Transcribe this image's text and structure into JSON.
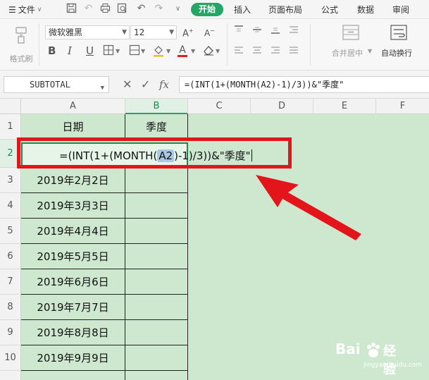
{
  "menubar": {
    "file": "文件",
    "tabs": [
      "开始",
      "插入",
      "页面布局",
      "公式",
      "数据",
      "审阅"
    ]
  },
  "ribbon": {
    "format_painter": "格式刷",
    "font_name": "微软雅黑",
    "font_size": "12",
    "merge_center": "合并居中",
    "wrap_text": "自动换行"
  },
  "formula_bar": {
    "name_box": "SUBTOTAL",
    "formula": "=(INT(1+(MONTH(A2)-1)/3))&\"季度\""
  },
  "sheet": {
    "columns": [
      "A",
      "B",
      "C",
      "D",
      "E",
      "F"
    ],
    "rows": [
      "1",
      "2",
      "3",
      "4",
      "5",
      "6",
      "7",
      "8",
      "9",
      "10"
    ],
    "header_a": "日期",
    "header_b": "季度",
    "edit": {
      "part1": "=(INT(1+(MONTH(",
      "ref": "A2",
      "part2": ")-1)/3))&\"季度\""
    },
    "dates": [
      "2019年2月2日",
      "2019年3月3日",
      "2019年4月4日",
      "2019年5月5日",
      "2019年6月6日",
      "2019年7月7日",
      "2019年8月8日",
      "2019年9月9日"
    ]
  },
  "watermark": {
    "brand": "Bai",
    "brand2": "经验",
    "url": "jingyan.baidu.com"
  },
  "colors": {
    "accent": "#24a665",
    "grid_bg": "#cde8cf",
    "highlight_frame": "#e3151a"
  }
}
